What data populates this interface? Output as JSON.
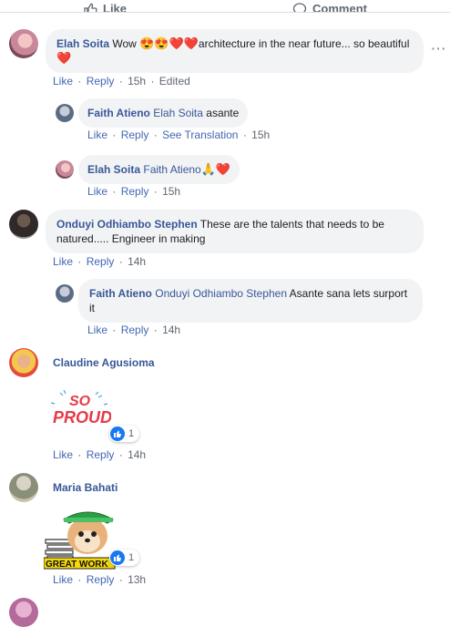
{
  "topbar": {
    "like_label": "Like",
    "comment_label": "Comment"
  },
  "labels": {
    "like": "Like",
    "reply": "Reply",
    "see_translation": "See Translation",
    "edited": "Edited",
    "sep": "·"
  },
  "comments": [
    {
      "author": "Elah Soita",
      "text_a": "Wow ",
      "emojis_a": "😍😍❤️❤️",
      "text_b": "architecture in the near future... so beautiful ",
      "emoji_b": "❤️",
      "time": "15h"
    },
    {
      "author": "Faith Atieno",
      "mention": "Elah Soita",
      "text": " asante",
      "time": "15h"
    },
    {
      "author": "Elah Soita",
      "mention": "Faith Atieno",
      "emojis": " 🙏❤️",
      "time": "15h"
    },
    {
      "author": "Onduyi Odhiambo Stephen",
      "text": " These are the talents that needs to be natured..... Engineer in making",
      "time": "14h"
    },
    {
      "author": "Faith Atieno",
      "mention": "Onduyi Odhiambo Stephen",
      "text": " Asante sana lets surport it",
      "time": "14h"
    },
    {
      "author": "Claudine Agusioma",
      "sticker_text_1": "SO",
      "sticker_text_2": "PROUD",
      "reactions": "1",
      "time": "14h"
    },
    {
      "author": "Maria Bahati",
      "sticker_text": "GREAT WORK",
      "reactions": "1",
      "time": "13h"
    }
  ],
  "colors": {
    "link": "#385898",
    "action": "#4267b2",
    "bubble": "#f2f3f5",
    "like_blue": "#1877f2"
  }
}
